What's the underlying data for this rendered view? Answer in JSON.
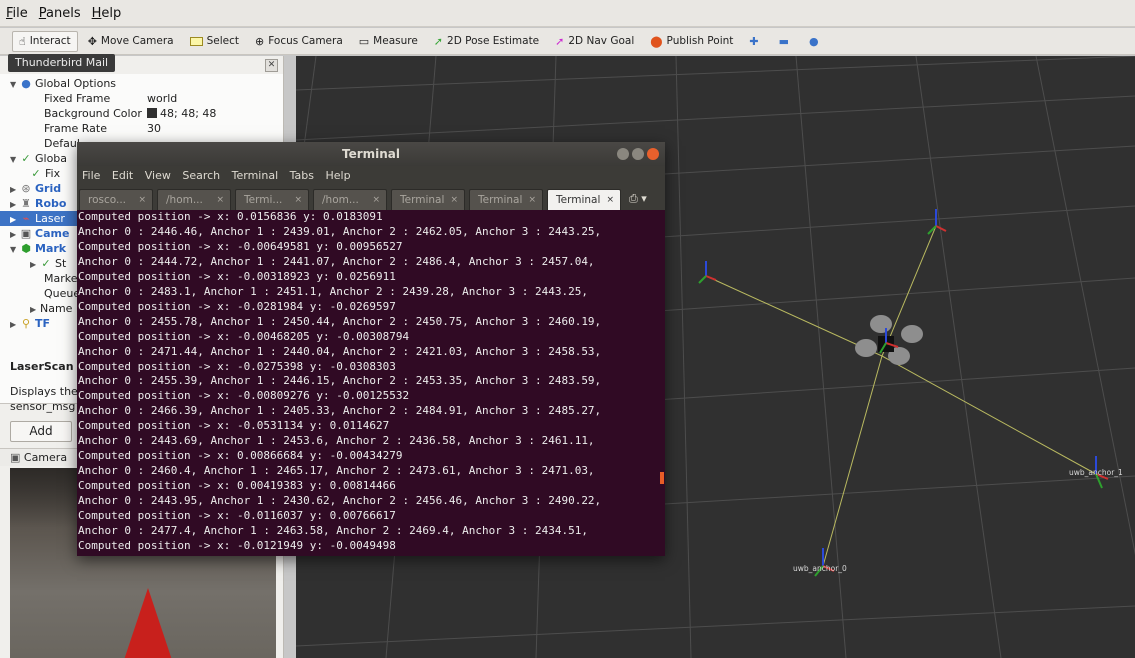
{
  "menubar": [
    "File",
    "Panels",
    "Help"
  ],
  "toolbar": {
    "interact": "Interact",
    "move_camera": "Move Camera",
    "select": "Select",
    "focus_camera": "Focus Camera",
    "measure": "Measure",
    "pose_estimate": "2D Pose Estimate",
    "nav_goal": "2D Nav Goal",
    "publish_point": "Publish Point"
  },
  "tooltip": "Thunderbird Mail",
  "displays": {
    "global_options": "Global Options",
    "fixed_frame_label": "Fixed Frame",
    "fixed_frame_value": "world",
    "bg_color_label": "Background Color",
    "bg_color_value": "48; 48; 48",
    "frame_rate_label": "Frame Rate",
    "frame_rate_value": "30",
    "default_label": "Defaul",
    "global_status": "Globa",
    "fix": "Fix",
    "grid": "Grid",
    "robot": "Robo",
    "laser": "Laser",
    "camera": "Came",
    "marker": "Mark",
    "status": "St",
    "markers": "Marke",
    "queue": "Queue",
    "namespaces": "Name",
    "tf": "TF"
  },
  "description": {
    "title": "LaserScan",
    "line1": "Displays the",
    "line2": "sensor_msg"
  },
  "add_button": "Add",
  "camera_panel": "Camera",
  "terminal": {
    "title": "Terminal",
    "menu": [
      "File",
      "Edit",
      "View",
      "Search",
      "Terminal",
      "Tabs",
      "Help"
    ],
    "tabs": [
      "rosco...",
      "/hom...",
      "Termi...",
      "/hom...",
      "Terminal",
      "Terminal",
      "Terminal"
    ],
    "lines": [
      "Computed position -> x: 0.0156836 y: 0.0183091",
      "Anchor 0 : 2446.46, Anchor 1 : 2439.01, Anchor 2 : 2462.05, Anchor 3 : 2443.25,",
      "Computed position -> x: -0.00649581 y: 0.00956527",
      "Anchor 0 : 2444.72, Anchor 1 : 2441.07, Anchor 2 : 2486.4, Anchor 3 : 2457.04,",
      "Computed position -> x: -0.00318923 y: 0.0256911",
      "Anchor 0 : 2483.1, Anchor 1 : 2451.1, Anchor 2 : 2439.28, Anchor 3 : 2443.25,",
      "Computed position -> x: -0.0281984 y: -0.0269597",
      "Anchor 0 : 2455.78, Anchor 1 : 2450.44, Anchor 2 : 2450.75, Anchor 3 : 2460.19,",
      "Computed position -> x: -0.00468205 y: -0.00308794",
      "Anchor 0 : 2471.44, Anchor 1 : 2440.04, Anchor 2 : 2421.03, Anchor 3 : 2458.53,",
      "Computed position -> x: -0.0275398 y: -0.0308303",
      "Anchor 0 : 2455.39, Anchor 1 : 2446.15, Anchor 2 : 2453.35, Anchor 3 : 2483.59,",
      "Computed position -> x: -0.00809276 y: -0.00125532",
      "Anchor 0 : 2466.39, Anchor 1 : 2405.33, Anchor 2 : 2484.91, Anchor 3 : 2485.27,",
      "Computed position -> x: -0.0531134 y: 0.0114627",
      "Anchor 0 : 2443.69, Anchor 1 : 2453.6, Anchor 2 : 2436.58, Anchor 3 : 2461.11,",
      "Computed position -> x: 0.00866684 y: -0.00434279",
      "Anchor 0 : 2460.4, Anchor 1 : 2465.17, Anchor 2 : 2473.61, Anchor 3 : 2471.03,",
      "Computed position -> x: 0.00419383 y: 0.00814466",
      "Anchor 0 : 2443.95, Anchor 1 : 2430.62, Anchor 2 : 2456.46, Anchor 3 : 2490.22,",
      "Computed position -> x: -0.0116037 y: 0.00766617",
      "Anchor 0 : 2477.4, Anchor 1 : 2463.58, Anchor 2 : 2469.4, Anchor 3 : 2434.51,",
      "Computed position -> x: -0.0121949 y: -0.0049498"
    ]
  },
  "scene_labels": {
    "anchor_0": "uwb_anchor_0",
    "anchor_1": "uwb_anchor_1"
  }
}
